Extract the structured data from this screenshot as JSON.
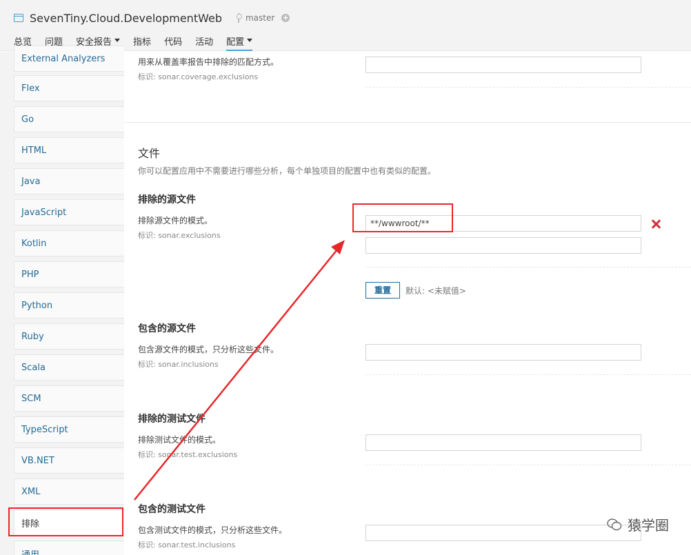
{
  "header": {
    "project_name": "SevenTiny.Cloud.DevelopmentWeb",
    "branch": "master"
  },
  "nav": {
    "items": [
      {
        "label": "总览"
      },
      {
        "label": "问题"
      },
      {
        "label": "安全报告"
      },
      {
        "label": "指标"
      },
      {
        "label": "代码"
      },
      {
        "label": "活动"
      },
      {
        "label": "配置"
      }
    ]
  },
  "sidebar": {
    "items": [
      {
        "label": "External Analyzers"
      },
      {
        "label": "Flex"
      },
      {
        "label": "Go"
      },
      {
        "label": "HTML"
      },
      {
        "label": "Java"
      },
      {
        "label": "JavaScript"
      },
      {
        "label": "Kotlin"
      },
      {
        "label": "PHP"
      },
      {
        "label": "Python"
      },
      {
        "label": "Ruby"
      },
      {
        "label": "Scala"
      },
      {
        "label": "SCM"
      },
      {
        "label": "TypeScript"
      },
      {
        "label": "VB.NET"
      },
      {
        "label": "XML"
      },
      {
        "label": "排除"
      },
      {
        "label": "通用"
      }
    ]
  },
  "main": {
    "coverage": {
      "description": "用来从覆盖率报告中排除的匹配方式。",
      "key": "标识: sonar.coverage.exclusions",
      "value": ""
    },
    "files": {
      "title": "文件",
      "description": "你可以配置应用中不需要进行哪些分析，每个单独项目的配置中也有类似的配置。"
    },
    "exclusions": {
      "title": "排除的源文件",
      "description": "排除源文件的模式。",
      "key": "标识: sonar.exclusions",
      "value": "**/wwwroot/**",
      "empty_value": "",
      "reset_label": "重置",
      "default_text": "默认: <未赋值>"
    },
    "inclusions": {
      "title": "包含的源文件",
      "description": "包含源文件的模式，只分析这些文件。",
      "key": "标识: sonar.inclusions",
      "value": ""
    },
    "test_exclusions": {
      "title": "排除的测试文件",
      "description": "排除测试文件的模式。",
      "key": "标识: sonar.test.exclusions",
      "value": ""
    },
    "test_inclusions": {
      "title": "包含的测试文件",
      "description": "包含测试文件的模式，只分析这些文件。",
      "key": "标识: sonar.test.inclusions",
      "value": ""
    }
  },
  "watermark": {
    "text": "猿学圈"
  },
  "colors": {
    "accent": "#4b9fd5",
    "link": "#236a97",
    "annotation_red": "#e8262a",
    "delete_red": "#d02f3a"
  }
}
